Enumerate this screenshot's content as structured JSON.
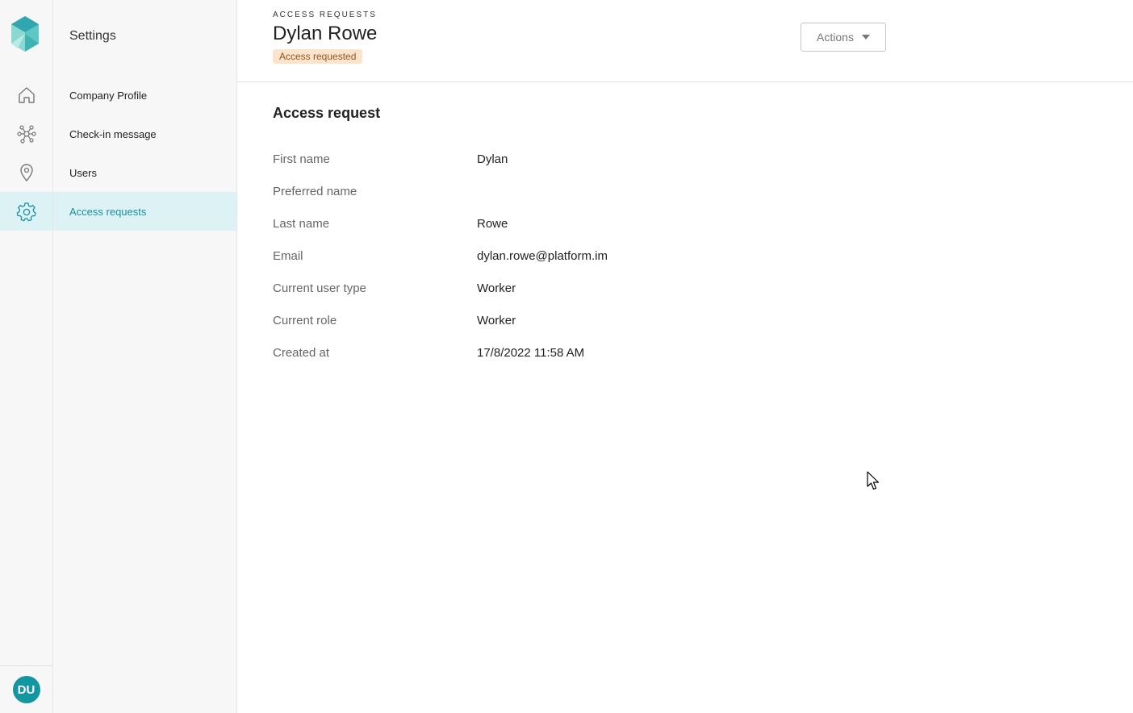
{
  "sidebar": {
    "title": "Settings",
    "items": [
      {
        "label": "Company Profile"
      },
      {
        "label": "Check-in message"
      },
      {
        "label": "Users"
      },
      {
        "label": "Access requests"
      }
    ]
  },
  "rail": {
    "icons": [
      "home-icon",
      "network-icon",
      "location-pin-icon",
      "gear-icon"
    ],
    "active": "gear-icon",
    "avatar_initials": "DU"
  },
  "header": {
    "eyebrow": "ACCESS REQUESTS",
    "title": "Dylan Rowe",
    "status": "Access requested",
    "actions_label": "Actions"
  },
  "section": {
    "title": "Access request",
    "fields": [
      {
        "label": "First name",
        "value": "Dylan"
      },
      {
        "label": "Preferred name",
        "value": ""
      },
      {
        "label": "Last name",
        "value": "Rowe"
      },
      {
        "label": "Email",
        "value": "dylan.rowe@platform.im"
      },
      {
        "label": "Current user type",
        "value": "Worker"
      },
      {
        "label": "Current role",
        "value": "Worker"
      },
      {
        "label": "Created at",
        "value": "17/8/2022 11:58 AM"
      }
    ]
  },
  "colors": {
    "accent": "#1a8f9c",
    "active_bg": "#ddf2f5",
    "badge_bg": "#fbe3cc",
    "avatar_bg": "#1496a0"
  }
}
